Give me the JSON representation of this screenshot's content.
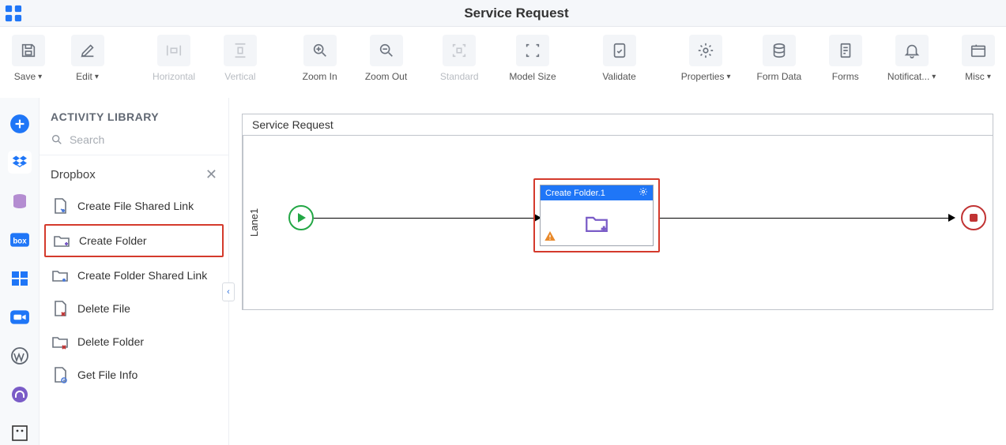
{
  "page_title": "Service Request",
  "toolbar": {
    "save": "Save",
    "edit": "Edit",
    "horizontal": "Horizontal",
    "vertical": "Vertical",
    "zoom_in": "Zoom In",
    "zoom_out": "Zoom Out",
    "standard": "Standard",
    "model_size": "Model Size",
    "validate": "Validate",
    "properties": "Properties",
    "form_data": "Form Data",
    "forms": "Forms",
    "notifications": "Notificat...",
    "misc": "Misc"
  },
  "library": {
    "header": "ACTIVITY LIBRARY",
    "search_placeholder": "Search",
    "group": "Dropbox",
    "items": {
      "0": "Create File Shared Link",
      "1": "Create Folder",
      "2": "Create Folder Shared Link",
      "3": "Delete File",
      "4": "Delete Folder",
      "5": "Get File Info"
    }
  },
  "canvas": {
    "title": "Service Request",
    "lane": "Lane1",
    "activity_name": "Create Folder.1"
  }
}
